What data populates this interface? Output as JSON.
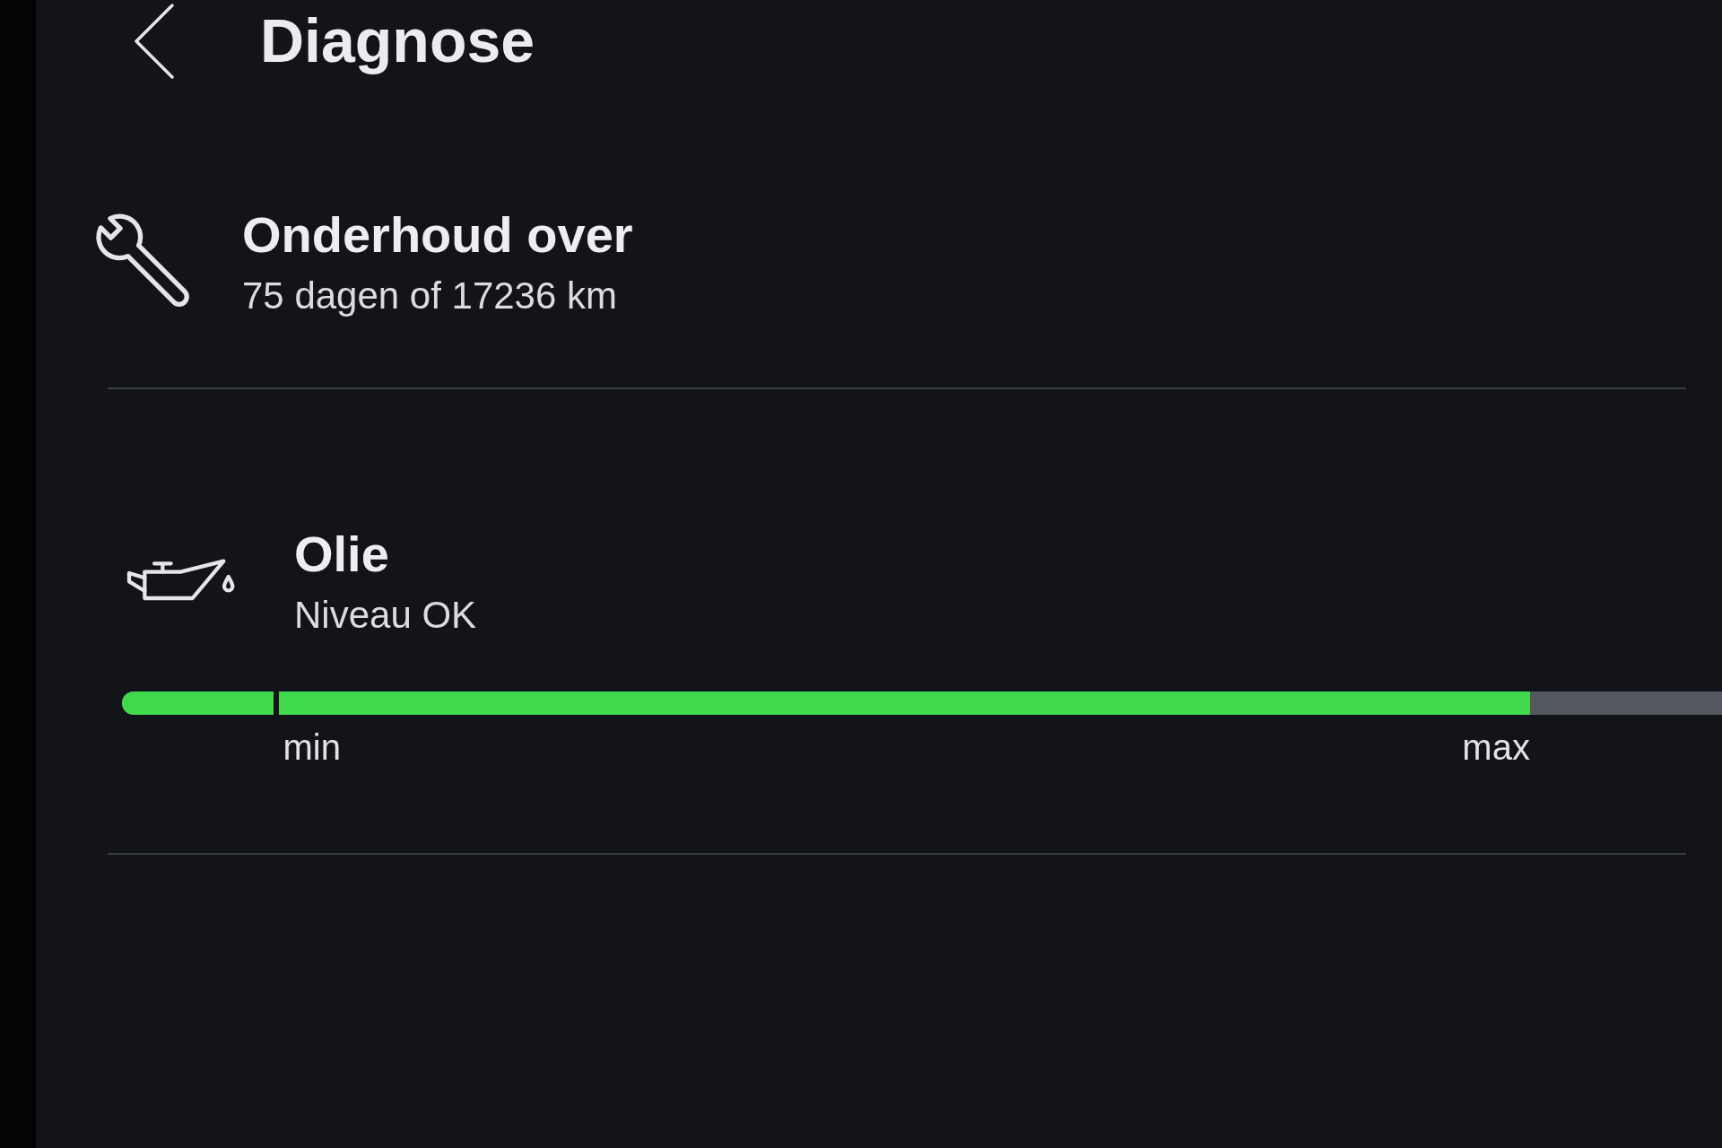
{
  "header": {
    "title": "Diagnose"
  },
  "maintenance": {
    "title": "Onderhoud over",
    "detail": "75 dagen of 17236 km"
  },
  "oil": {
    "title": "Olie",
    "status": "Niveau OK",
    "gauge": {
      "level": 0.88,
      "min_label": "min",
      "max_label": "max"
    }
  }
}
